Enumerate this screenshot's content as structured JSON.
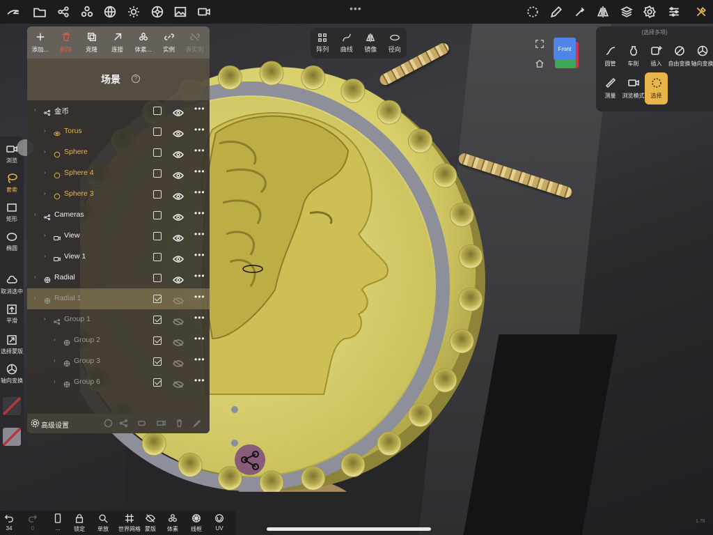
{
  "topbar": {
    "icons": [
      "app-logo-icon",
      "folder-icon",
      "share-nodes-icon",
      "shapes-icon",
      "globe-icon",
      "sun-icon",
      "material-icon",
      "image-icon",
      "video-icon",
      "lasso-select-icon",
      "pencil-icon",
      "eyedropper-icon",
      "mirror-icon",
      "layers-icon",
      "settings-icon",
      "sliders-icon",
      "tools-icon"
    ],
    "more": "•••"
  },
  "scene": {
    "toolbar": [
      {
        "label": "添加...",
        "icon": "plus-icon",
        "state": "normal"
      },
      {
        "label": "删除",
        "icon": "trash-icon",
        "state": "danger"
      },
      {
        "label": "克隆",
        "icon": "clone-icon",
        "state": "normal"
      },
      {
        "label": "连接",
        "icon": "connect-icon",
        "state": "normal"
      },
      {
        "label": "体素...",
        "icon": "voxel-icon",
        "state": "normal"
      },
      {
        "label": "实例",
        "icon": "instance-link-icon",
        "state": "normal"
      },
      {
        "label": "表实例",
        "icon": "unlink-icon",
        "state": "dim"
      }
    ],
    "title": "场景",
    "help": "?",
    "rows": [
      {
        "name": "金币",
        "icon": "group-icon",
        "style": "normal",
        "checked": false,
        "visible": true,
        "more": "•••"
      },
      {
        "name": "Torus",
        "icon": "torus-icon",
        "style": "gold",
        "checked": false,
        "visible": true,
        "more": "•••"
      },
      {
        "name": "Sphere",
        "icon": "sphere-icon",
        "style": "gold",
        "checked": false,
        "visible": true,
        "more": "•••"
      },
      {
        "name": "Sphere 4",
        "icon": "sphere-icon",
        "style": "gold",
        "checked": false,
        "visible": true,
        "more": "•••"
      },
      {
        "name": "Sphere 3",
        "icon": "sphere-icon",
        "style": "gold",
        "checked": false,
        "visible": true,
        "more": "•••"
      },
      {
        "name": "Cameras",
        "icon": "group-icon",
        "style": "normal",
        "checked": false,
        "visible": true,
        "more": "•••"
      },
      {
        "name": "View",
        "icon": "camera-icon",
        "style": "normal",
        "checked": false,
        "visible": true,
        "more": "•••"
      },
      {
        "name": "View 1",
        "icon": "camera-icon",
        "style": "normal",
        "checked": false,
        "visible": true,
        "more": "•••"
      },
      {
        "name": "Radial",
        "icon": "radial-icon",
        "style": "normal",
        "checked": false,
        "visible": true,
        "more": "•••"
      },
      {
        "name": "Radial 1",
        "icon": "radial-icon",
        "style": "ghost-sel",
        "checked": true,
        "visible": false,
        "more": "•••"
      },
      {
        "name": "Group 1",
        "icon": "group-icon",
        "style": "ghost",
        "checked": true,
        "visible": false,
        "more": "•••"
      },
      {
        "name": "Group 2",
        "icon": "radial-icon",
        "style": "ghost",
        "checked": true,
        "visible": false,
        "more": "•••"
      },
      {
        "name": "Group 3",
        "icon": "radial-icon",
        "style": "ghost",
        "checked": true,
        "visible": false,
        "more": "•••"
      },
      {
        "name": "Group 6",
        "icon": "radial-icon",
        "style": "ghost",
        "checked": true,
        "visible": false,
        "more": "•••"
      }
    ],
    "footer": {
      "label": "高级设置"
    }
  },
  "midtool": [
    {
      "label": "阵列",
      "icon": "grid-array-icon"
    },
    {
      "label": "曲线",
      "icon": "curve-icon"
    },
    {
      "label": "镜像",
      "icon": "mirror-icon"
    },
    {
      "label": "径向",
      "icon": "radial-ring-icon"
    }
  ],
  "viewcube": {
    "face": "Front"
  },
  "rightpanel": {
    "title": "(选择多项)",
    "items": [
      {
        "label": "圆管",
        "icon": "pipe-icon",
        "active": false
      },
      {
        "label": "车削",
        "icon": "lathe-icon",
        "active": false
      },
      {
        "label": "插入",
        "icon": "insert-icon",
        "active": false
      },
      {
        "label": "自由变换",
        "icon": "free-transform-icon",
        "active": false
      },
      {
        "label": "轴向变换",
        "icon": "gizmo-icon",
        "active": false
      },
      {
        "label": "测量",
        "icon": "ruler-icon",
        "active": false
      },
      {
        "label": "浏览模式",
        "icon": "camera-icon",
        "active": false
      },
      {
        "label": "选择",
        "icon": "select-dashed-icon",
        "active": true
      }
    ]
  },
  "leftrail": [
    {
      "label": "浏览",
      "icon": "camera-icon",
      "active": false
    },
    {
      "label": "套索",
      "icon": "lasso-icon",
      "active": true
    },
    {
      "label": "矩形",
      "icon": "rectangle-icon",
      "active": false
    },
    {
      "label": "椭圆",
      "icon": "ellipse-icon",
      "active": false
    },
    {
      "label": "取消选中",
      "icon": "cloud-icon",
      "active": false
    },
    {
      "label": "平滑",
      "icon": "smooth-icon",
      "active": false
    },
    {
      "label": "选择蒙版",
      "icon": "mask-icon",
      "active": false
    },
    {
      "label": "轴向变换",
      "icon": "gizmo-icon",
      "active": false
    }
  ],
  "bottombar": [
    {
      "label": "34",
      "icon": "undo-icon"
    },
    {
      "label": "0",
      "icon": "redo-icon"
    },
    {
      "label": "...",
      "icon": "device-icon"
    },
    {
      "label": "锁定",
      "icon": "lock-icon"
    },
    {
      "label": "单放",
      "icon": "search-zoom-icon"
    },
    {
      "label": "世界网格",
      "icon": "world-grid-icon"
    },
    {
      "label": "蒙版",
      "icon": "mask-off-icon"
    },
    {
      "label": "体素",
      "icon": "voxel-icon"
    },
    {
      "label": "线框",
      "icon": "wireframe-icon"
    },
    {
      "label": "UV",
      "icon": "uv-icon"
    }
  ],
  "version": "1.76",
  "colors": {
    "accent": "#e8b54a",
    "danger": "#e4554c",
    "coin_gold": "#d8cf6a",
    "torus_gray": "#8d8f9a"
  }
}
